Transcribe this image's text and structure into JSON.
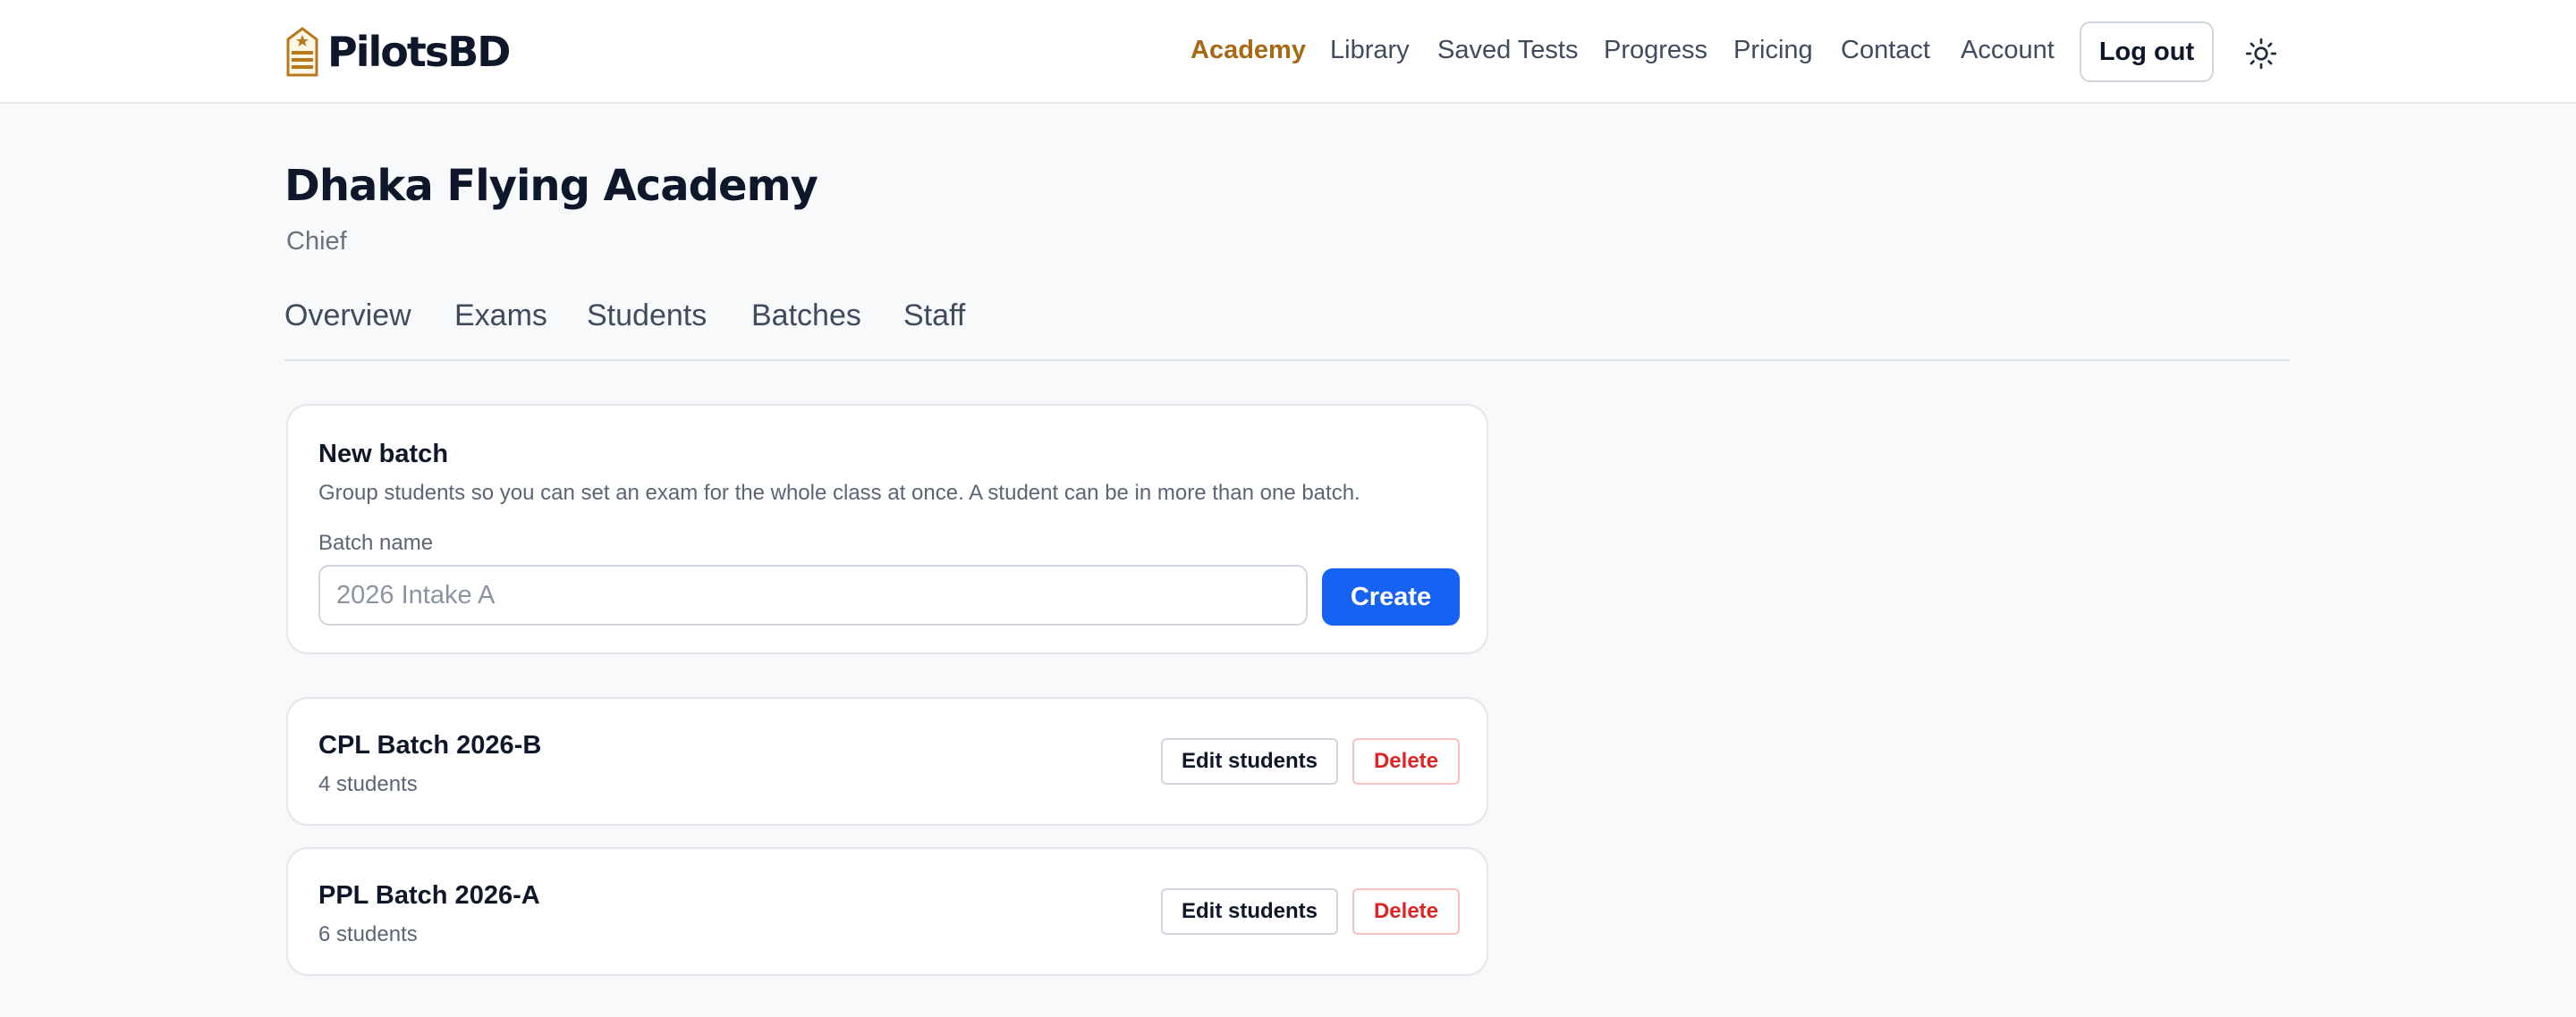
{
  "header": {
    "brand": "PilotsBD",
    "nav": [
      {
        "label": "Academy",
        "active": true
      },
      {
        "label": "Library",
        "active": false
      },
      {
        "label": "Saved Tests",
        "active": false
      },
      {
        "label": "Progress",
        "active": false
      },
      {
        "label": "Pricing",
        "active": false
      },
      {
        "label": "Contact",
        "active": false
      },
      {
        "label": "Account",
        "active": false
      }
    ],
    "logout_label": "Log out",
    "theme_icon": "sun-icon"
  },
  "page": {
    "title": "Dhaka Flying Academy",
    "role": "Chief"
  },
  "tabs": [
    {
      "label": "Overview"
    },
    {
      "label": "Exams"
    },
    {
      "label": "Students"
    },
    {
      "label": "Batches"
    },
    {
      "label": "Staff"
    }
  ],
  "new_batch": {
    "title": "New batch",
    "description": "Group students so you can set an exam for the whole class at once. A student can be in more than one batch.",
    "field_label": "Batch name",
    "placeholder": "2026 Intake A",
    "value": "",
    "create_label": "Create"
  },
  "batches": [
    {
      "name": "CPL Batch 2026-B",
      "count": "4 students",
      "edit_label": "Edit students",
      "delete_label": "Delete"
    },
    {
      "name": "PPL Batch 2026-A",
      "count": "6 students",
      "edit_label": "Edit students",
      "delete_label": "Delete"
    }
  ],
  "colors": {
    "accent": "#a56a14",
    "primary": "#1662f3",
    "danger": "#dc2626",
    "background": "#f8f9fb"
  }
}
